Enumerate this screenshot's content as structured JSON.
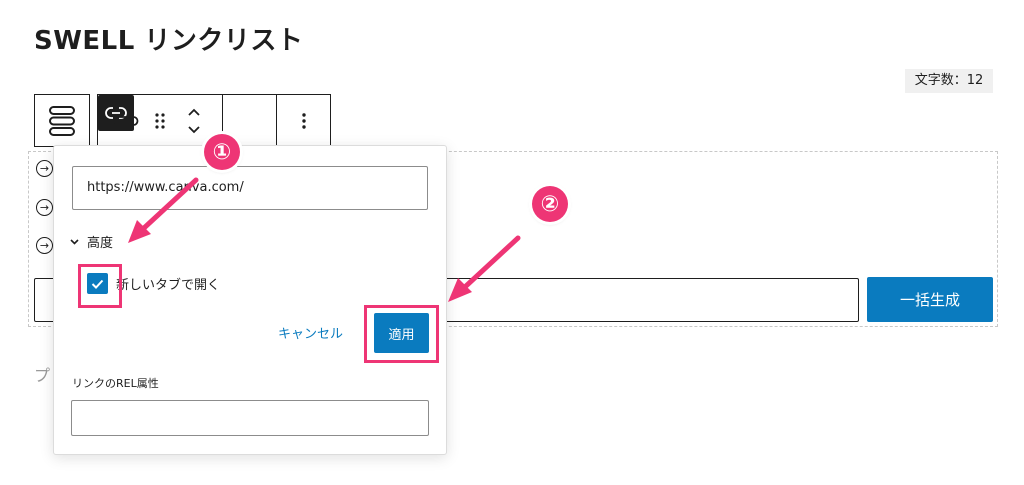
{
  "page": {
    "title": "SWELL リンクリスト"
  },
  "status": {
    "char_count": "文字数：12"
  },
  "toolbar": {
    "parent_icon": "list-block-icon",
    "buttons": [
      "button-shape-icon",
      "drag-handle-icon",
      "move-up-down-icon",
      "link-icon",
      "more-options-icon"
    ]
  },
  "editor": {
    "generator_button": "一括生成",
    "placeholder_fragment": "プ",
    "row_icon": "arrow-circle-right-icon"
  },
  "link_popover": {
    "url_value": "https://www.canva.com/",
    "advanced_label": "高度",
    "new_tab_label": "新しいタブで開く",
    "new_tab_checked": true,
    "cancel_label": "キャンセル",
    "apply_label": "適用",
    "rel_label": "リンクのREL属性",
    "rel_value": ""
  },
  "annotations": {
    "step1": "①",
    "step2": "②",
    "highlight_color": "#ee3575"
  },
  "colors": {
    "accent": "#0a7bbf",
    "annotation": "#ee3575"
  }
}
